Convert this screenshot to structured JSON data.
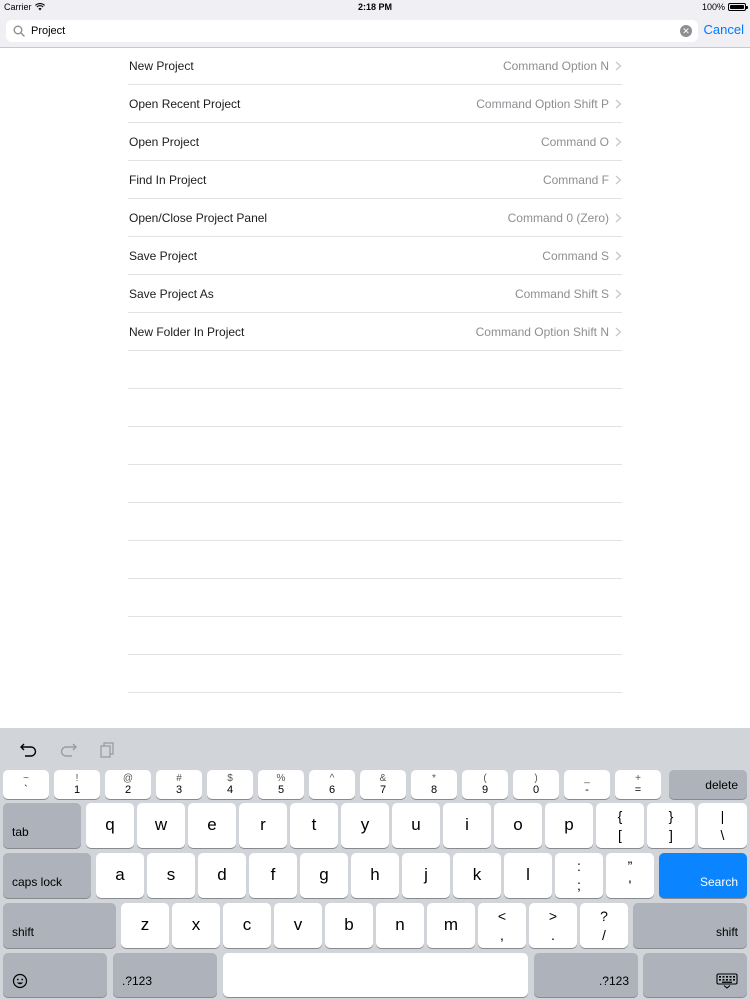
{
  "status_bar": {
    "carrier": "Carrier",
    "time": "2:18 PM",
    "battery": "100%"
  },
  "search": {
    "query": "Project",
    "cancel_label": "Cancel"
  },
  "results": [
    {
      "title": "New Project",
      "shortcut": "Command Option N"
    },
    {
      "title": "Open Recent Project",
      "shortcut": "Command Option Shift P"
    },
    {
      "title": "Open Project",
      "shortcut": "Command O"
    },
    {
      "title": "Find In Project",
      "shortcut": "Command F"
    },
    {
      "title": "Open/Close Project Panel",
      "shortcut": "Command 0 (Zero)"
    },
    {
      "title": "Save Project",
      "shortcut": "Command S"
    },
    {
      "title": "Save Project As",
      "shortcut": "Command Shift S"
    },
    {
      "title": "New Folder In Project",
      "shortcut": "Command Option Shift N"
    }
  ],
  "keyboard": {
    "toolbar": [
      "undo-icon",
      "redo-icon",
      "paste-icon"
    ],
    "number_row": [
      {
        "top": "~",
        "bottom": "`"
      },
      {
        "top": "!",
        "bottom": "1"
      },
      {
        "top": "@",
        "bottom": "2"
      },
      {
        "top": "#",
        "bottom": "3"
      },
      {
        "top": "$",
        "bottom": "4"
      },
      {
        "top": "%",
        "bottom": "5"
      },
      {
        "top": "^",
        "bottom": "6"
      },
      {
        "top": "&",
        "bottom": "7"
      },
      {
        "top": "*",
        "bottom": "8"
      },
      {
        "top": "(",
        "bottom": "9"
      },
      {
        "top": ")",
        "bottom": "0"
      },
      {
        "top": "_",
        "bottom": "-"
      },
      {
        "top": "+",
        "bottom": "="
      }
    ],
    "delete_label": "delete",
    "tab_label": "tab",
    "row_q": [
      "q",
      "w",
      "e",
      "r",
      "t",
      "y",
      "u",
      "i",
      "o",
      "p"
    ],
    "row_q_symbols": [
      {
        "top": "{",
        "bottom": "["
      },
      {
        "top": "}",
        "bottom": "]"
      },
      {
        "top": "|",
        "bottom": "\\"
      }
    ],
    "caps_lock_label": "caps lock",
    "row_a": [
      "a",
      "s",
      "d",
      "f",
      "g",
      "h",
      "j",
      "k",
      "l"
    ],
    "row_a_symbols": [
      {
        "top": ":",
        "bottom": ";"
      },
      {
        "top": "”",
        "bottom": "'"
      }
    ],
    "search_label": "Search",
    "shift_label": "shift",
    "row_z": [
      "z",
      "x",
      "c",
      "v",
      "b",
      "n",
      "m"
    ],
    "row_z_symbols": [
      {
        "top": "<",
        "bottom": ","
      },
      {
        "top": ">",
        "bottom": "."
      },
      {
        "top": "?",
        "bottom": "/"
      }
    ],
    "numbers_label": ".?123",
    "emoji_icon": "emoji-icon",
    "dismiss_icon": "keyboard-dismiss-icon",
    "colors": {
      "background": "#d1d4d9",
      "key": "#ffffff",
      "function_key": "#adb2bb",
      "search_key": "#0a84ff"
    }
  },
  "colors": {
    "accent": "#007aff",
    "shortcut_text": "#8e8e93"
  }
}
